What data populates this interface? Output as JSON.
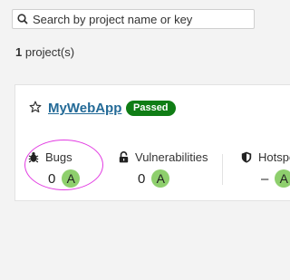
{
  "search": {
    "placeholder": "Search by project name or key"
  },
  "summary": {
    "count": "1",
    "suffix": " project(s)"
  },
  "project": {
    "name": "MyWebApp",
    "quality_gate": "Passed",
    "metrics": [
      {
        "label": "Bugs",
        "value": "0",
        "rating": "A",
        "icon": "bug-icon"
      },
      {
        "label": "Vulnerabilities",
        "value": "0",
        "rating": "A",
        "icon": "lock-icon"
      },
      {
        "label": "Hotspots",
        "value": "–",
        "rating": "A",
        "icon": "shield-icon"
      }
    ]
  },
  "colors": {
    "passed_badge": "#0f7d15",
    "rating_a": "#8ecf6d",
    "link": "#236a97",
    "annotation": "#e23be2"
  }
}
